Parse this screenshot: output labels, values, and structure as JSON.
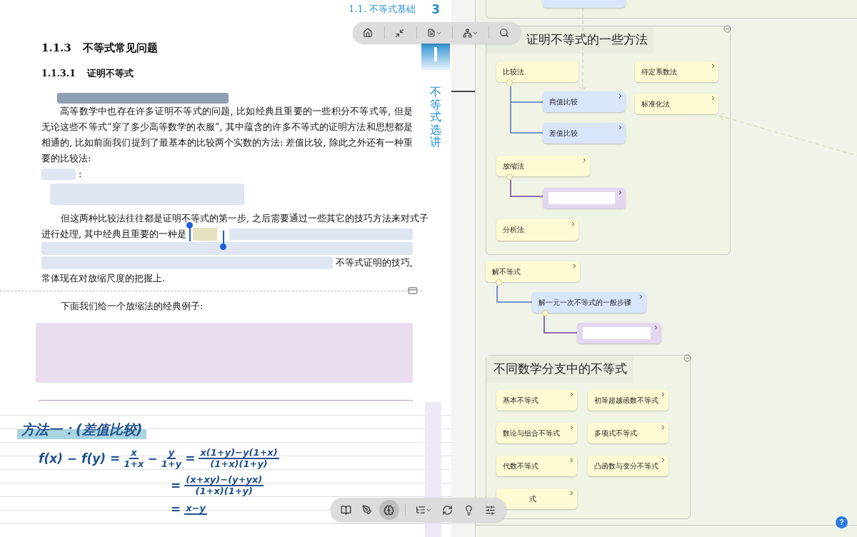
{
  "page": {
    "header_section": "1.1.  不等式基础",
    "page_number": "3",
    "side_tab": "不等式选讲",
    "section_title": "1.1.3",
    "section_name": "不等式常见问题",
    "subsection_title": "1.1.3.1",
    "subsection_name": "证明不等式",
    "paragraph_1": {
      "text": "高等数学中也存在许多证明不等式的问题, 比如经典且重要的一些积分不等式等, 但是无论这些不等式“穿了多少高等数学的衣服”, 其中蕴含的许多不等式的证明方法和思想都是相通的, 比如前面我们提到了最基本的比较两个实数的方法: 差值比较, 除此之外还有一种重要的比较法:",
      "ending": ":"
    },
    "paragraph_2": [
      {
        "kind": "text",
        "text": "但这两种比较法往往都是证明不等式的第一步, 之后需要通过一些其它的技巧方法来对式子"
      },
      {
        "kind": "lead",
        "text": "进行处理, 其中经典且重要的一种是"
      },
      {
        "kind": "blurline"
      },
      {
        "kind": "tail",
        "text": "不等式证明的技巧,"
      },
      {
        "kind": "text",
        "text": "常体现在对放缩尺度的把握上."
      }
    ],
    "paragraph_3": "下面我们给一个放缩法的经典例子:"
  },
  "notes": {
    "heading": "方法一：(差值比较)",
    "lines": [
      [
        {
          "kind": "text",
          "text": "f(x) − f(y) ="
        },
        {
          "kind": "frac",
          "num": "x",
          "den": "1+x"
        },
        {
          "kind": "text",
          "text": "−"
        },
        {
          "kind": "frac",
          "num": "y",
          "den": "1+y"
        },
        {
          "kind": "text",
          "text": "="
        },
        {
          "kind": "frac",
          "num": "x(1+y)−y(1+x)",
          "den": "(1+x)(1+y)"
        }
      ],
      [
        {
          "kind": "text",
          "text": "="
        },
        {
          "kind": "frac",
          "num": "(x+xy)−(y+yx)",
          "den": "(1+x)(1+y)"
        }
      ],
      [
        {
          "kind": "text",
          "text": "="
        },
        {
          "kind": "frac",
          "num": "x−y"
        }
      ]
    ]
  },
  "top_toolbar": {
    "tools": [
      {
        "selected": false
      },
      {
        "selected": false
      },
      {
        "selected": false
      },
      {
        "selected": false
      },
      {
        "selected": false
      }
    ]
  },
  "bottom_toolbar": {
    "tools": [
      {
        "selected": false
      },
      {
        "selected": false
      },
      {
        "selected": true
      },
      {
        "selected": false
      },
      {
        "selected": false
      },
      {
        "selected": false
      },
      {
        "selected": false
      }
    ]
  },
  "mind_map": {
    "groups": [
      "证明不等式的一些方法",
      "不同数学分支中的不等式"
    ],
    "nodes": [
      {
        "kind": "stub",
        "color": "#d8e6fb"
      },
      {
        "kind": "topic",
        "label": "比较法",
        "color": "#fdfbd3",
        "more": false,
        "expanded": true
      },
      {
        "kind": "topic",
        "label": "商值比较",
        "color": "#d8e6fb",
        "more": true,
        "expanded": false
      },
      {
        "kind": "topic",
        "label": "差值比较",
        "color": "#d8e6fb",
        "more": true,
        "expanded": false
      },
      {
        "kind": "topic",
        "label": "待定系数法",
        "color": "#fdfbd3",
        "more": true,
        "expanded": false
      },
      {
        "kind": "topic",
        "label": "标准化法",
        "color": "#fdfbd3",
        "more": true,
        "expanded": false
      },
      {
        "kind": "topic",
        "label": "放缩法",
        "color": "#fdfbd3",
        "more": true,
        "expanded": true
      },
      {
        "kind": "image",
        "color": "#e5d6f0",
        "more": true,
        "expanded": false
      },
      {
        "kind": "topic",
        "label": "分析法",
        "color": "#fdfbd3",
        "more": true,
        "expanded": false
      },
      {
        "kind": "topic",
        "label": "解不等式",
        "color": "#fdfbd3",
        "more": true,
        "expanded": true
      },
      {
        "kind": "topic",
        "label": "解一元一次不等式的一般步骤",
        "color": "#d8e6fb",
        "more": true,
        "expanded": true
      },
      {
        "kind": "image",
        "color": "#e5d6f0",
        "more": true,
        "expanded": false
      },
      {
        "kind": "topic",
        "label": "基本不等式",
        "color": "#fdfbd3",
        "more": true,
        "expanded": false
      },
      {
        "kind": "topic",
        "label": "初等超越函数不等式",
        "color": "#fdfbd3",
        "more": true,
        "expanded": false
      },
      {
        "kind": "topic",
        "label": "数论与组合不等式",
        "color": "#fdfbd3",
        "more": true,
        "expanded": false
      },
      {
        "kind": "topic",
        "label": "多项式不等式",
        "color": "#fdfbd3",
        "more": true,
        "expanded": false
      },
      {
        "kind": "topic",
        "label": "代数不等式",
        "color": "#fdfbd3",
        "more": true,
        "expanded": false
      },
      {
        "kind": "topic",
        "label": "凸函数与变分不等式",
        "color": "#fdfbd3",
        "more": true,
        "expanded": false
      },
      {
        "kind": "clipped",
        "label": "式",
        "color": "#fdfbd3",
        "more": true,
        "expanded": false
      }
    ]
  },
  "help": "?"
}
